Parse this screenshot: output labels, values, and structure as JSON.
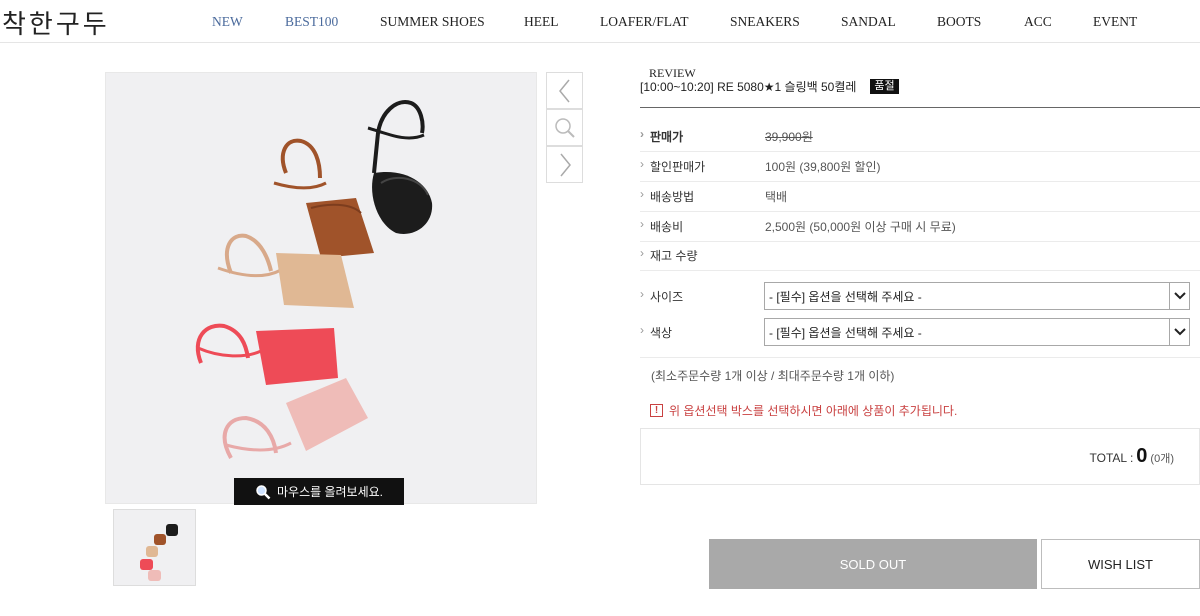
{
  "brand": {
    "logo_text": "착한구두"
  },
  "nav": {
    "items": [
      {
        "label": "NEW"
      },
      {
        "label": "BEST100"
      },
      {
        "label": "SUMMER SHOES"
      },
      {
        "label": "HEEL"
      },
      {
        "label": "LOAFER/FLAT"
      },
      {
        "label": "SNEAKERS"
      },
      {
        "label": "SANDAL"
      },
      {
        "label": "BOOTS"
      },
      {
        "label": "ACC"
      },
      {
        "label": "EVENT"
      }
    ]
  },
  "gallery": {
    "hover_text": "마우스를 올려보세요."
  },
  "product": {
    "review_label": "REVIEW",
    "name": "[10:00~10:20] RE 5080★1 슬링백 50켤레",
    "soldout_badge": "품절",
    "info": [
      {
        "label": "판매가",
        "value": "39,900원"
      },
      {
        "label": "할인판매가",
        "value": "100원 (39,800원 할인)"
      },
      {
        "label": "배송방법",
        "value": "택배"
      },
      {
        "label": "배송비",
        "value": "2,500원 (50,000원 이상 구매 시 무료)"
      },
      {
        "label": "재고 수량",
        "value": ""
      }
    ],
    "options": [
      {
        "label": "사이즈",
        "selected": "- [필수] 옵션을 선택해 주세요 -"
      },
      {
        "label": "색상",
        "selected": "- [필수] 옵션을 선택해 주세요 -"
      }
    ],
    "qty_note": "(최소주문수량 1개 이상 / 최대주문수량 1개 이하)",
    "warning": "위 옵션선택 박스를 선택하시면 아래에 상품이 추가됩니다.",
    "warning_icon": "!",
    "total": {
      "label": "TOTAL :",
      "amount": "0",
      "count": "(0개)"
    }
  },
  "actions": {
    "soldout_label": "SOLD OUT",
    "wishlist_label": "WISH LIST"
  },
  "colors": {
    "nav_highlight": "#4a6a9c",
    "warning": "#c94141",
    "soldout_button": "#a9a9a9",
    "sandals": [
      "#1c1c1c",
      "#a0532a",
      "#e0b894",
      "#ee4b57",
      "#efbcb8"
    ]
  }
}
